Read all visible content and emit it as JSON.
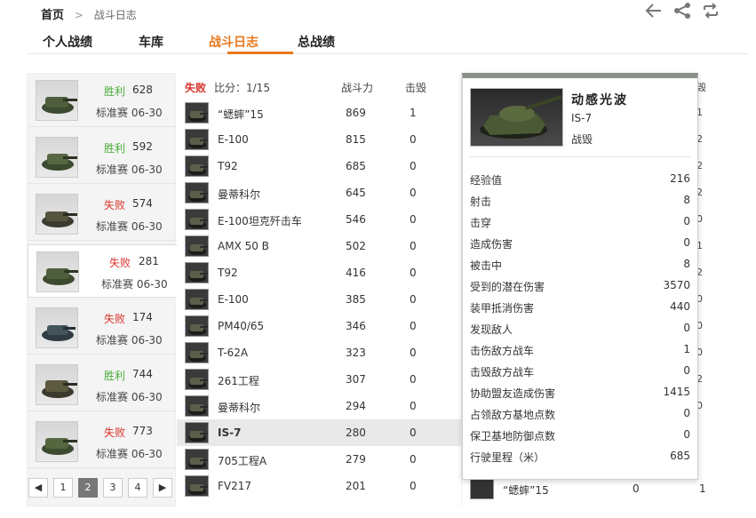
{
  "breadcrumb": {
    "home": "首页",
    "sep": ">",
    "current": "战斗日志"
  },
  "tabs": [
    "个人战绩",
    "车库",
    "战斗日志",
    "总战绩"
  ],
  "battles": [
    {
      "result": "胜利",
      "kind": "win",
      "score": "628",
      "mode": "标准赛 06-30"
    },
    {
      "result": "胜利",
      "kind": "win",
      "score": "592",
      "mode": "标准赛 06-30"
    },
    {
      "result": "失败",
      "kind": "lose",
      "score": "574",
      "mode": "标准赛 06-30"
    },
    {
      "result": "失败",
      "kind": "lose",
      "score": "281",
      "mode": "标准赛 06-30"
    },
    {
      "result": "失败",
      "kind": "lose",
      "score": "174",
      "mode": "标准赛 06-30"
    },
    {
      "result": "胜利",
      "kind": "win",
      "score": "744",
      "mode": "标准赛 06-30"
    },
    {
      "result": "失败",
      "kind": "lose",
      "score": "773",
      "mode": "标准赛 06-30"
    }
  ],
  "pager": {
    "prev": "◀",
    "pages": [
      "1",
      "2",
      "3",
      "4"
    ],
    "next": "▶",
    "current": "2"
  },
  "table": {
    "result": "失败",
    "ratio": "比分：1/15",
    "col_power": "战斗力",
    "col_kills": "击毁",
    "rows": [
      {
        "name": "“蟋蟀”15",
        "power": "869",
        "kills": "1"
      },
      {
        "name": "E-100",
        "power": "815",
        "kills": "0"
      },
      {
        "name": "T92",
        "power": "685",
        "kills": "0"
      },
      {
        "name": "曼蒂科尔",
        "power": "645",
        "kills": "0"
      },
      {
        "name": "E-100坦克歼击车",
        "power": "546",
        "kills": "0"
      },
      {
        "name": "AMX 50 B",
        "power": "502",
        "kills": "0"
      },
      {
        "name": "T92",
        "power": "416",
        "kills": "0"
      },
      {
        "name": "E-100",
        "power": "385",
        "kills": "0"
      },
      {
        "name": "PM40/65",
        "power": "346",
        "kills": "0"
      },
      {
        "name": "T-62A",
        "power": "323",
        "kills": "0"
      },
      {
        "name": "261工程",
        "power": "307",
        "kills": "0"
      },
      {
        "name": "曼蒂科尔",
        "power": "294",
        "kills": "0"
      },
      {
        "name": "IS-7",
        "power": "280",
        "kills": "0"
      },
      {
        "name": "705工程A",
        "power": "279",
        "kills": "0"
      },
      {
        "name": "FV217",
        "power": "201",
        "kills": "0"
      }
    ]
  },
  "right_column": {
    "header": "毁",
    "cells": [
      "1",
      "2",
      "2",
      "2",
      "0",
      "1",
      "2",
      "0",
      "0",
      "0",
      "2",
      "0"
    ],
    "bottom": {
      "name": "“蟋蟀”15",
      "power": "0",
      "kills": "1"
    }
  },
  "popup": {
    "player": "动感光波",
    "tank": "IS-7",
    "status": "战毁",
    "stats": [
      {
        "label": "经验值",
        "value": "216"
      },
      {
        "label": "射击",
        "value": "8"
      },
      {
        "label": "击穿",
        "value": "0"
      },
      {
        "label": "造成伤害",
        "value": "0"
      },
      {
        "label": "被击中",
        "value": "8"
      },
      {
        "label": "受到的潜在伤害",
        "value": "3570"
      },
      {
        "label": "装甲抵消伤害",
        "value": "440"
      },
      {
        "label": "发现敌人",
        "value": "0"
      },
      {
        "label": "击伤敌方战车",
        "value": "1"
      },
      {
        "label": "击毁敌方战车",
        "value": "0"
      },
      {
        "label": "协助盟友造成伤害",
        "value": "1415"
      },
      {
        "label": "占领敌方基地点数",
        "value": "0"
      },
      {
        "label": "保卫基地防御点数",
        "value": "0"
      },
      {
        "label": "行驶里程（米）",
        "value": "685"
      }
    ]
  },
  "colors": {
    "accent": "#e8791d",
    "win": "#4bad3a",
    "lose": "#d9322c"
  },
  "icons": [
    "back-arrow-icon",
    "share-icon",
    "refresh-icon"
  ]
}
